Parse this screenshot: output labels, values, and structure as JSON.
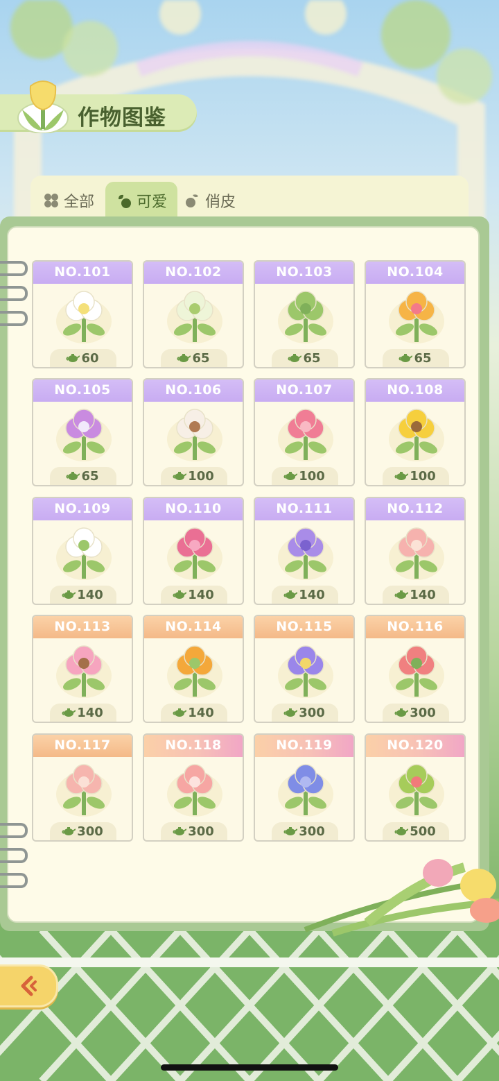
{
  "header": {
    "title": "作物图鉴"
  },
  "tabs": [
    {
      "label": "全部",
      "icon": "clover-icon",
      "active": false
    },
    {
      "label": "可爱",
      "icon": "sprout-icon",
      "active": true
    },
    {
      "label": "俏皮",
      "icon": "seedling-icon",
      "active": false
    }
  ],
  "colors": {
    "lilac": "#c8acf2",
    "peach": "#f4b988",
    "pink": "#f1a6c6",
    "accent": "#cfe2a0"
  },
  "crops": [
    {
      "no": "NO.101",
      "cost": "60",
      "head": "lilac",
      "art": "white-daisy-icon"
    },
    {
      "no": "NO.102",
      "cost": "65",
      "head": "lilac",
      "art": "white-shrub-icon"
    },
    {
      "no": "NO.103",
      "cost": "65",
      "head": "lilac",
      "art": "green-leaves-icon"
    },
    {
      "no": "NO.104",
      "cost": "65",
      "head": "lilac",
      "art": "celosia-icon"
    },
    {
      "no": "NO.105",
      "cost": "65",
      "head": "lilac",
      "art": "pansy-icon"
    },
    {
      "no": "NO.106",
      "cost": "100",
      "head": "lilac",
      "art": "plum-blossom-icon"
    },
    {
      "no": "NO.107",
      "cost": "100",
      "head": "lilac",
      "art": "azalea-icon"
    },
    {
      "no": "NO.108",
      "cost": "100",
      "head": "lilac",
      "art": "sunflower-icon"
    },
    {
      "no": "NO.109",
      "cost": "140",
      "head": "lilac",
      "art": "calla-lily-icon"
    },
    {
      "no": "NO.110",
      "cost": "140",
      "head": "lilac",
      "art": "pink-hydrangea-icon"
    },
    {
      "no": "NO.111",
      "cost": "140",
      "head": "lilac",
      "art": "purple-flower-icon"
    },
    {
      "no": "NO.112",
      "cost": "140",
      "head": "lilac",
      "art": "gladiolus-icon"
    },
    {
      "no": "NO.113",
      "cost": "140",
      "head": "peach",
      "art": "cherry-blossom-icon"
    },
    {
      "no": "NO.114",
      "cost": "140",
      "head": "peach",
      "art": "lantern-fruit-icon"
    },
    {
      "no": "NO.115",
      "cost": "300",
      "head": "peach",
      "art": "aster-icon"
    },
    {
      "no": "NO.116",
      "cost": "300",
      "head": "peach",
      "art": "red-lily-icon"
    },
    {
      "no": "NO.117",
      "cost": "300",
      "head": "peach",
      "art": "peony-icon"
    },
    {
      "no": "NO.118",
      "cost": "300",
      "head": "pink",
      "art": "rose-icon"
    },
    {
      "no": "NO.119",
      "cost": "300",
      "head": "pink",
      "art": "blue-hydrangea-icon"
    },
    {
      "no": "NO.120",
      "cost": "500",
      "head": "pink",
      "art": "cactus-icon"
    }
  ]
}
